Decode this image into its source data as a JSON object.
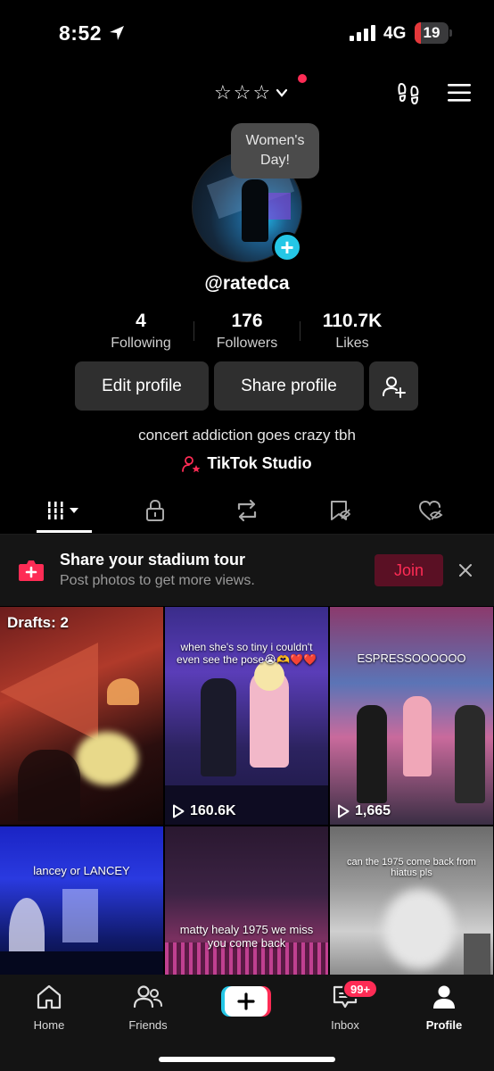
{
  "status_bar": {
    "time": "8:52",
    "network": "4G",
    "battery": "19",
    "battery_level": 0.19
  },
  "header": {
    "title": "☆☆☆"
  },
  "profile": {
    "bubble_text": "Women's Day!",
    "username": "@ratedca",
    "stats": [
      {
        "value": "4",
        "label": "Following"
      },
      {
        "value": "176",
        "label": "Followers"
      },
      {
        "value": "110.7K",
        "label": "Likes"
      }
    ],
    "buttons": {
      "edit": "Edit profile",
      "share": "Share profile"
    },
    "bio": "concert addiction goes crazy tbh",
    "studio_link": "TikTok Studio"
  },
  "banner": {
    "title": "Share your stadium tour",
    "subtitle": "Post photos to get more views.",
    "join": "Join"
  },
  "grid": [
    {
      "drafts": "Drafts: 2",
      "caption": "",
      "views": ""
    },
    {
      "drafts": "",
      "caption": "when she's so tiny i couldn't even see the pose😭🫶❤️❤️",
      "views": "160.6K"
    },
    {
      "drafts": "",
      "caption": "ESPRESSOOOOOO",
      "views": "1,665"
    },
    {
      "drafts": "",
      "caption": "lancey or LANCEY",
      "views": ""
    },
    {
      "drafts": "",
      "caption": "matty healy 1975 we miss you come back",
      "views": ""
    },
    {
      "drafts": "",
      "caption": "can the 1975 come back from hiatus pls",
      "views": ""
    }
  ],
  "tabbar": {
    "home": "Home",
    "friends": "Friends",
    "inbox": "Inbox",
    "inbox_badge": "99+",
    "profile": "Profile"
  },
  "colors": {
    "accent": "#fe2c55",
    "plus": "#25c7e6",
    "background": "#000000"
  }
}
